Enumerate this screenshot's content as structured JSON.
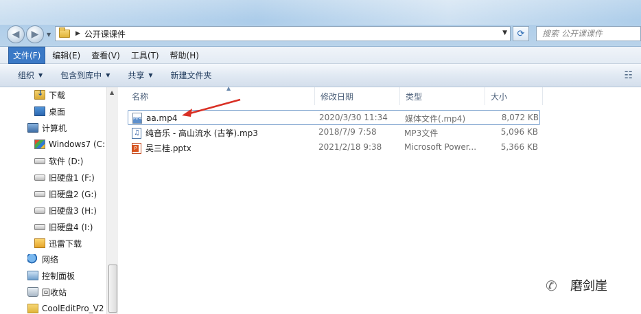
{
  "window": {
    "address": {
      "crumb": "公开课课件"
    },
    "search": {
      "placeholder": "搜索 公开课课件"
    }
  },
  "menu": [
    "文件(F)",
    "编辑(E)",
    "查看(V)",
    "工具(T)",
    "帮助(H)"
  ],
  "toolbar": [
    {
      "label": "组织",
      "dropdown": true
    },
    {
      "label": "包含到库中",
      "dropdown": true
    },
    {
      "label": "共享",
      "dropdown": true
    },
    {
      "label": "新建文件夹",
      "dropdown": false
    }
  ],
  "nav": [
    {
      "label": "下载",
      "icon": "download-folder-icon"
    },
    {
      "label": "桌面",
      "icon": "desktop-icon"
    },
    {
      "label": "计算机",
      "icon": "computer-icon"
    },
    {
      "label": "Windows7 (C:",
      "icon": "windows-drive-icon"
    },
    {
      "label": "软件 (D:)",
      "icon": "drive-icon"
    },
    {
      "label": "旧硬盘1 (F:)",
      "icon": "drive-icon"
    },
    {
      "label": "旧硬盘2 (G:)",
      "icon": "drive-icon"
    },
    {
      "label": "旧硬盘3 (H:)",
      "icon": "drive-icon"
    },
    {
      "label": "旧硬盘4 (I:)",
      "icon": "drive-icon"
    },
    {
      "label": "迅雷下载",
      "icon": "xunlei-folder-icon"
    },
    {
      "label": "网络",
      "icon": "network-icon"
    },
    {
      "label": "控制面板",
      "icon": "control-panel-icon"
    },
    {
      "label": "回收站",
      "icon": "recycle-bin-icon"
    },
    {
      "label": "CoolEditPro_V2",
      "icon": "folder-icon"
    }
  ],
  "columns": [
    "名称",
    "修改日期",
    "类型",
    "大小"
  ],
  "files": [
    {
      "name": "aa.mp4",
      "date": "2020/3/30 11:34",
      "type": "媒体文件(.mp4)",
      "size": "8,072 KB",
      "icon": "mp4-file-icon",
      "selected": true
    },
    {
      "name": "纯音乐 - 高山流水 (古筝).mp3",
      "date": "2018/7/9 7:58",
      "type": "MP3文件",
      "size": "5,096 KB",
      "icon": "mp3-file-icon",
      "selected": false
    },
    {
      "name": "吴三桂.pptx",
      "date": "2021/2/18 9:38",
      "type": "Microsoft Power...",
      "size": "5,366 KB",
      "icon": "pptx-file-icon",
      "selected": false
    }
  ],
  "annotation": {
    "color": "#d93025"
  },
  "watermark": {
    "text": "磨剑崖"
  }
}
